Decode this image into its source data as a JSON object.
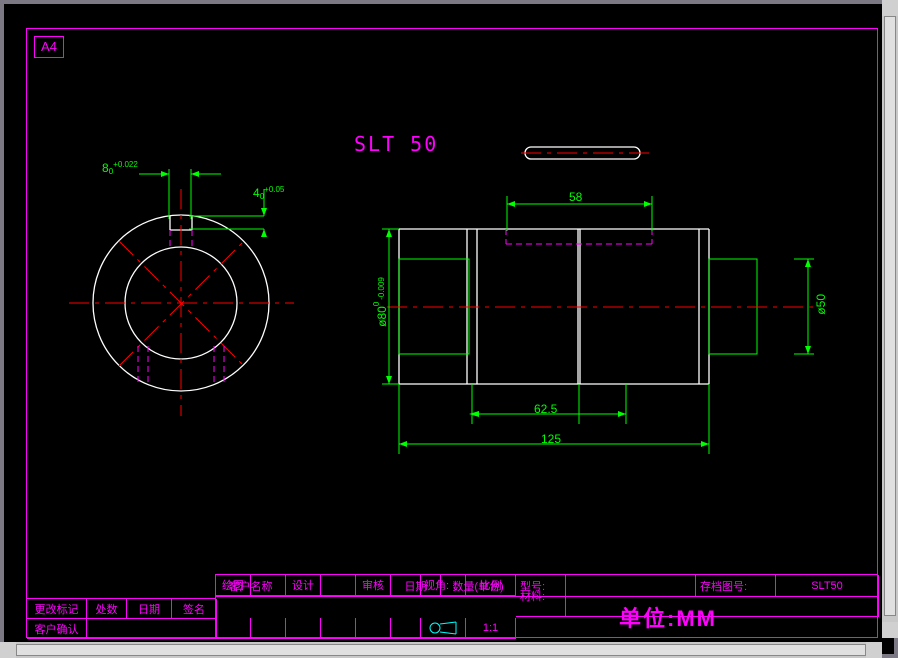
{
  "page_format": "A4",
  "drawing_title": "SLT 50",
  "front_view": {
    "dim_keyway_width": "8",
    "dim_keyway_width_tol": "+0.022",
    "dim_keyway_width_tol_low": "0",
    "dim_key_depth": "4",
    "dim_key_depth_tol": "+0.05",
    "dim_key_depth_tol_low": "0"
  },
  "side_view": {
    "dim_slot_width": "58",
    "dim_half_length": "62.5",
    "dim_full_length": "125",
    "dim_outer_dia": "ø80",
    "dim_outer_dia_tol_up": "0",
    "dim_outer_dia_tol_low": "-0.009",
    "dim_shaft_dia": "ø50"
  },
  "title_block": {
    "customer_name_lbl": "客户名称",
    "date_lbl": "日期",
    "qty_lbl": "数量(单台)",
    "model_lbl": "型号:",
    "archive_lbl": "存档图号:",
    "archive_val": "SLT50",
    "material_lbl": "材料:",
    "drawn_lbl": "绘图",
    "design_lbl": "设计",
    "check_lbl": "审核",
    "angle_lbl": "视角:",
    "scale_lbl": "比例",
    "scale_val": "1:1",
    "unit_lbl": "单位:MM",
    "rev_mark_lbl": "更改标记",
    "handle_lbl": "处数",
    "rev_date_lbl": "日期",
    "sign_lbl": "签名",
    "cust_confirm_lbl": "客户确认"
  }
}
